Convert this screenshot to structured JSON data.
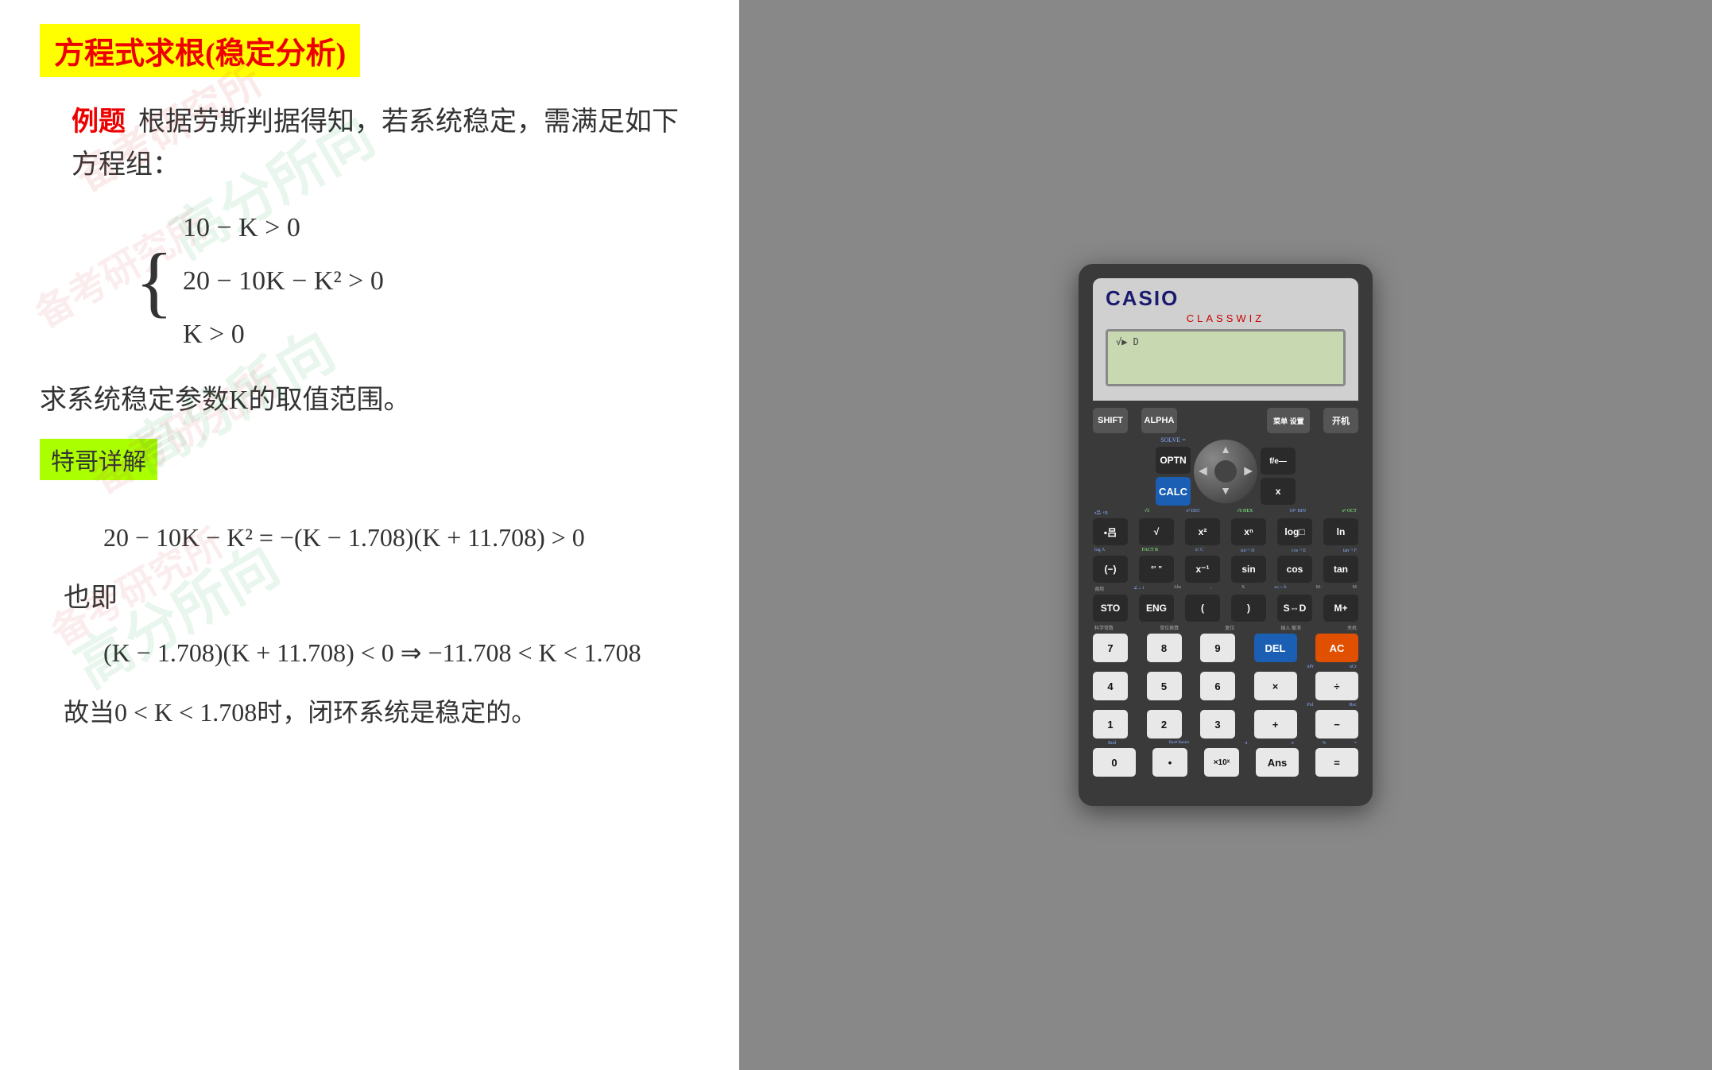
{
  "left": {
    "title": "方程式求根(稳定分析)",
    "example_label": "例题",
    "example_text": "根据劳斯判据得知，若系统稳定，需满足如下方程组：",
    "eq1": "10 − K > 0",
    "eq2": "20 − 10K − K² > 0",
    "eq3": "K > 0",
    "desc": "求系统稳定参数K的取值范围。",
    "detail_label": "特哥详解",
    "math1": "20 − 10K − K² = −(K − 1.708)(K + 11.708) > 0",
    "also": "也即",
    "math2": "(K − 1.708)(K + 11.708) < 0  ⇒  −11.708 < K < 1.708",
    "conclusion": "故当0 < K < 1.708时，闭环系统是稳定的。"
  },
  "calc": {
    "brand": "CASIO",
    "model": "CLASSWIZ",
    "screen_icon": "√▶ D",
    "buttons": {
      "shift": "SHIFT",
      "alpha": "ALPHA",
      "menu": "菜单 设置",
      "power": "开机",
      "solve_label": "SOLVE =",
      "optn": "OPTN",
      "calc": "CALC",
      "frac_btn": "f/e—",
      "x_btn": "x",
      "row2_labels": "▪吕 +R  √5  x³ DEC √6 HEX 10ᵐ BIN eⁿ OCT",
      "table": "▪吕",
      "sqrt": "√",
      "sq": "x²",
      "xn": "xⁿ",
      "log": "log□",
      "ln": "ln",
      "row3_labels": "log A  FACT B  x! C  sin⁻¹ D  cos⁻¹ E  tan⁻¹ F",
      "neg": "(−)",
      "deg": "°' \"",
      "xinv": "x⁻¹",
      "sin": "sin",
      "cos": "cos",
      "tan": "tan",
      "row4_labels": "调用  ∠←i  Abs  ,  X  a≤⇔b  M−  M",
      "sto": "STO",
      "eng": "ENG",
      "lpar": "(",
      "rpar": ")",
      "sd": "S⇔D",
      "mplus": "M+",
      "row5_labels": "科学常数  单位换算  复位  插入 撤消  关机",
      "n7": "7",
      "n8": "8",
      "n9": "9",
      "del": "DEL",
      "ac": "AC",
      "n4": "4",
      "n5": "5",
      "n6": "6",
      "mul": "×",
      "div": "÷",
      "n1": "1",
      "n2": "2",
      "n3": "3",
      "plus": "+",
      "minus": "−",
      "n0": "0",
      "dot": "•",
      "exp": "×10ˣ",
      "ans": "Ans",
      "equals": "=",
      "sub_npr": "nPr",
      "sub_ncr": "nCr",
      "sub_pol": "Pol",
      "sub_rec": "Rec",
      "sub_rnd": "Rnd",
      "sub_ran": "Ran# Ranint",
      "sub_pi": "π",
      "sub_e": "e",
      "sub_pct": "%",
      "sub_approx": "≈"
    }
  }
}
